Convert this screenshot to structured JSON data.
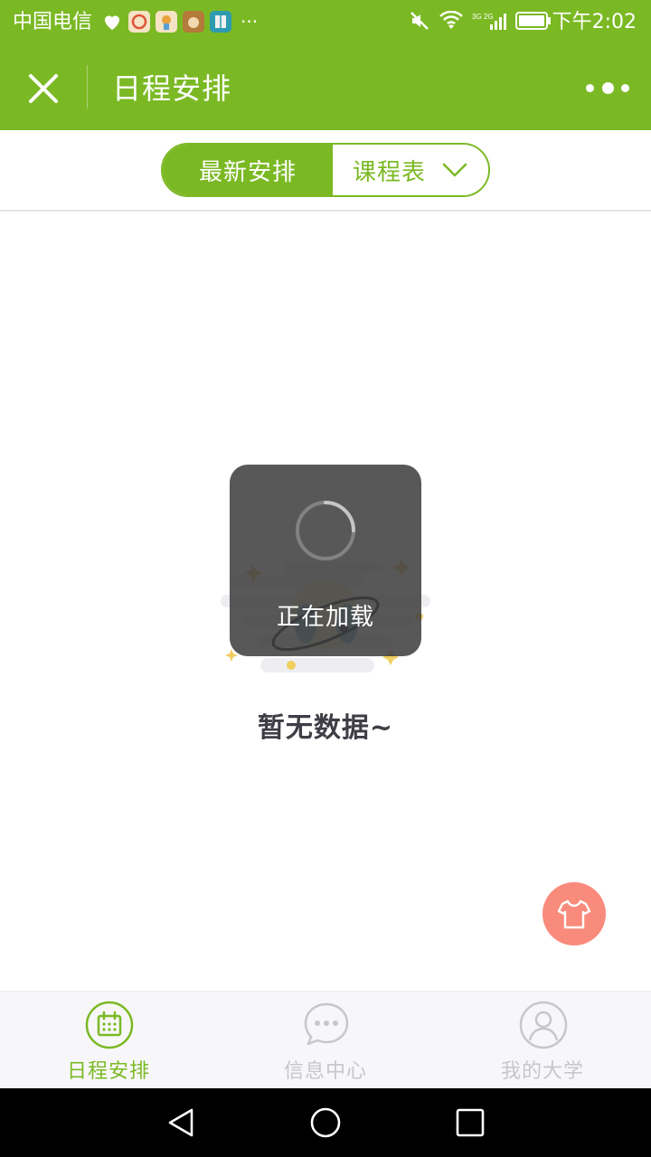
{
  "status_bar": {
    "carrier": "中国电信",
    "more": "···",
    "time": "下午2:02",
    "network": "3G 2G"
  },
  "header": {
    "title": "日程安排"
  },
  "segment": {
    "active_label": "最新安排",
    "inactive_label": "课程表"
  },
  "empty_state": {
    "text": "暂无数据~"
  },
  "loading": {
    "text": "正在加载"
  },
  "tabs": [
    {
      "label": "日程安排",
      "icon": "calendar-icon",
      "active": true
    },
    {
      "label": "信息中心",
      "icon": "chat-bubble-icon",
      "active": false
    },
    {
      "label": "我的大学",
      "icon": "user-profile-icon",
      "active": false
    }
  ],
  "colors": {
    "brand": "#7bb924",
    "fab": "#f98b7c",
    "inactive_tab": "#c6c6cc"
  }
}
